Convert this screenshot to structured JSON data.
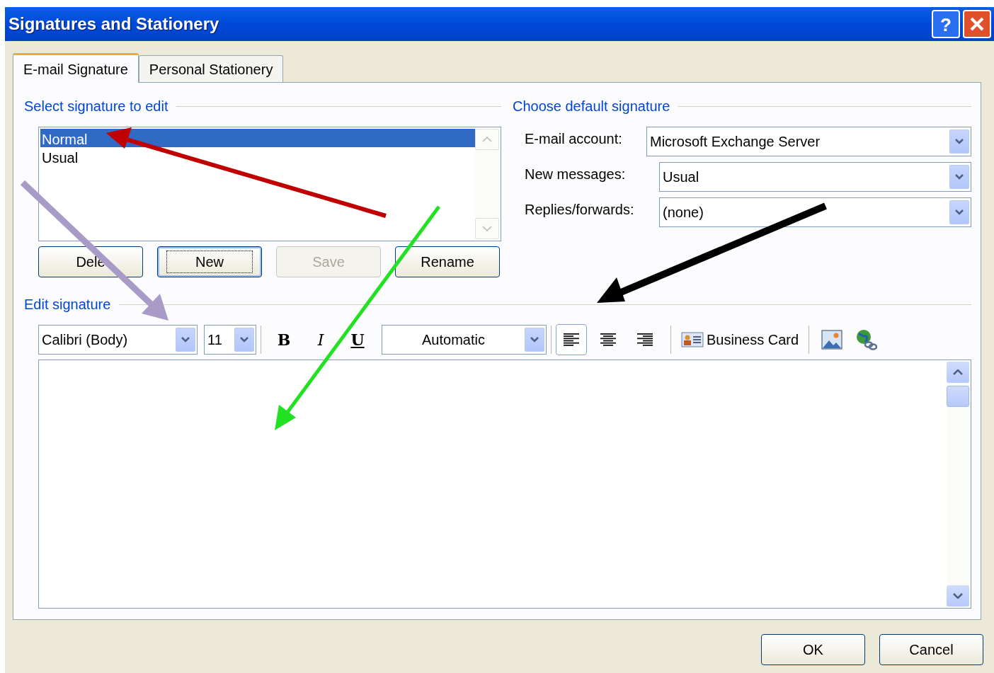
{
  "window": {
    "title": "Signatures and Stationery",
    "help": "?"
  },
  "tabs": [
    {
      "label": "E-mail Signature",
      "selected": true
    },
    {
      "label": "Personal Stationery",
      "selected": false
    }
  ],
  "select_section": {
    "heading": "Select signature to edit",
    "signatures": [
      {
        "label": "Normal",
        "selected": true
      },
      {
        "label": "Usual",
        "selected": false
      }
    ],
    "buttons": [
      {
        "label": "Dele",
        "disabled": false,
        "focused": false
      },
      {
        "label": "New",
        "disabled": false,
        "focused": true
      },
      {
        "label": "Save",
        "disabled": true,
        "focused": false
      },
      {
        "label": "Rename",
        "disabled": false,
        "focused": false
      }
    ]
  },
  "default_section": {
    "heading": "Choose default signature",
    "fields": [
      {
        "label": "E-mail account:",
        "value": "Microsoft Exchange Server"
      },
      {
        "label": "New messages:",
        "value": "Usual"
      },
      {
        "label": "Replies/forwards:",
        "value": "(none)"
      }
    ]
  },
  "edit_section": {
    "heading": "Edit signature",
    "font": "Calibri (Body)",
    "size": "11",
    "styles": [
      {
        "kind": "bold",
        "label": "B"
      },
      {
        "kind": "italic",
        "label": "I"
      },
      {
        "kind": "underline",
        "label": "U"
      }
    ],
    "font_color_choice": "Automatic",
    "alignments": [
      {
        "kind": "left",
        "selected": true
      },
      {
        "kind": "center",
        "selected": false
      },
      {
        "kind": "right",
        "selected": false
      }
    ],
    "business_card": "Business Card"
  },
  "footer_buttons": [
    "OK",
    "Cancel"
  ]
}
